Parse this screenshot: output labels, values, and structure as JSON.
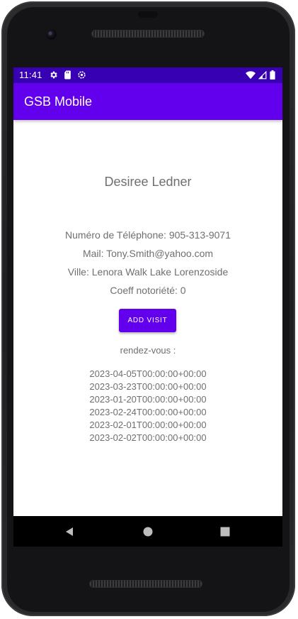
{
  "status_bar": {
    "time": "11:41",
    "left_icons": [
      "gear-icon",
      "sd-card-icon",
      "settings-cog-icon"
    ],
    "right_icons": [
      "wifi-icon",
      "signal-icon",
      "battery-icon"
    ],
    "color": "#3700b3"
  },
  "app_bar": {
    "title": "GSB Mobile",
    "color": "#6200ee"
  },
  "practitioner": {
    "name": "Desiree Ledner",
    "phone_line": "Numéro de Téléphone: 905-313-9071",
    "mail_line": "Mail: Tony.Smith@yahoo.com",
    "city_line": "Ville: Lenora Walk Lake Lorenzoside",
    "coeff_line": "Coeff notoriété: 0"
  },
  "actions": {
    "add_visit_label": "ADD VISIT"
  },
  "appointments": {
    "label": "rendez-vous :",
    "items": [
      "2023-04-05T00:00:00+00:00",
      "2023-03-23T00:00:00+00:00",
      "2023-01-20T00:00:00+00:00",
      "2023-02-24T00:00:00+00:00",
      "2023-02-01T00:00:00+00:00",
      "2023-02-02T00:00:00+00:00"
    ]
  },
  "navigation": {
    "buttons": [
      "back-icon",
      "home-icon",
      "recents-icon"
    ]
  }
}
